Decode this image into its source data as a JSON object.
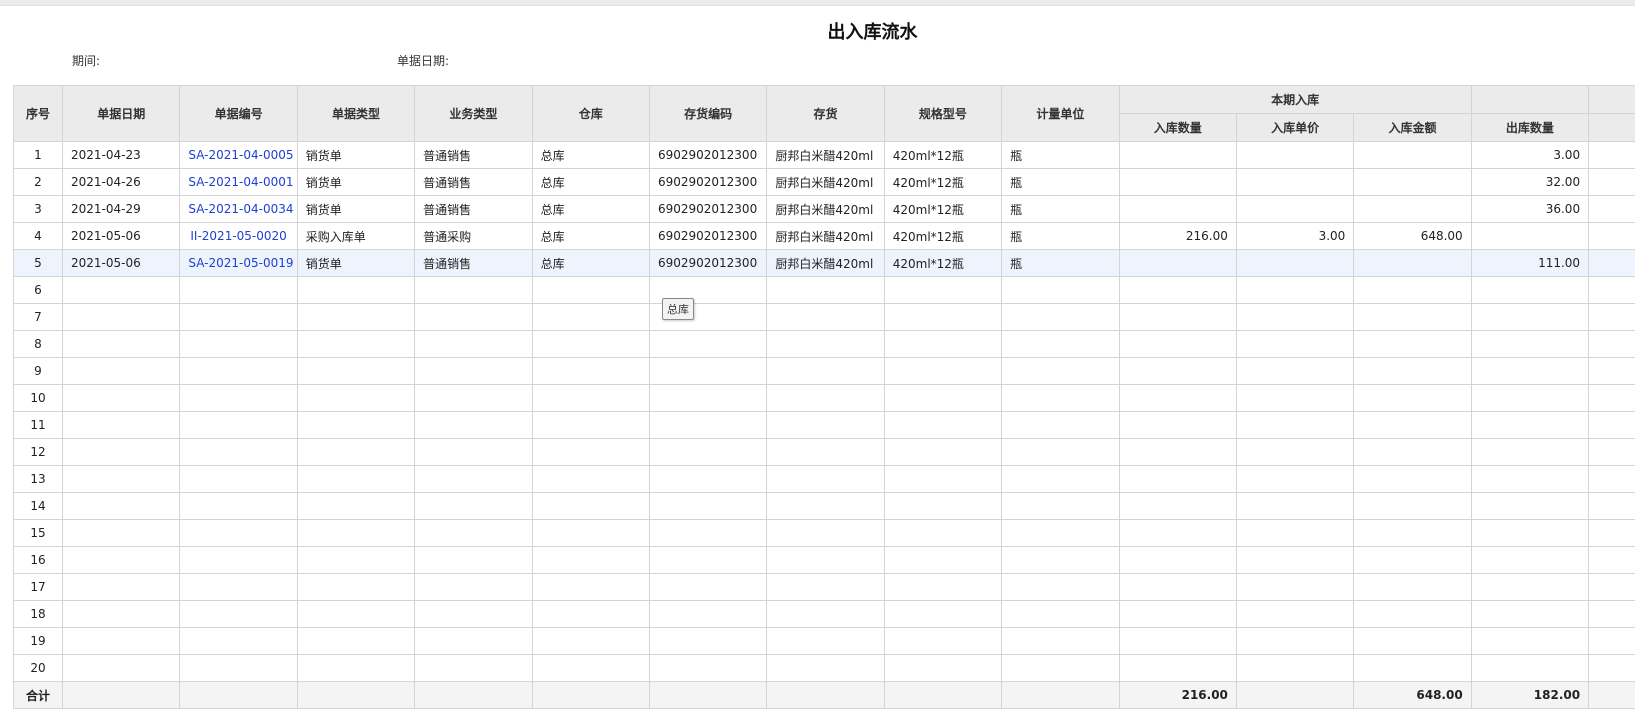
{
  "report": {
    "title": "出入库流水",
    "period_label": "期间:",
    "doc_date_label": "单据日期:"
  },
  "table": {
    "headers": {
      "seq": "序号",
      "doc_date": "单据日期",
      "doc_no": "单据编号",
      "doc_type": "单据类型",
      "biz_type": "业务类型",
      "warehouse": "仓库",
      "item_code": "存货编码",
      "item": "存货",
      "spec": "规格型号",
      "unit": "计量单位",
      "in_group": "本期入库",
      "in_qty": "入库数量",
      "in_price": "入库单价",
      "in_amount": "入库金额",
      "out_qty": "出库数量"
    },
    "rows": [
      {
        "seq": "1",
        "date": "2021-04-23",
        "doc_no": "SA-2021-04-0005",
        "doc_type": "销货单",
        "biz_type": "普通销售",
        "warehouse": "总库",
        "item_code": "6902902012300",
        "item": "厨邦白米醋420ml",
        "spec": "420ml*12瓶",
        "unit": "瓶",
        "in_qty": "",
        "in_price": "",
        "in_amount": "",
        "out_qty": "3.00"
      },
      {
        "seq": "2",
        "date": "2021-04-26",
        "doc_no": "SA-2021-04-0001",
        "doc_type": "销货单",
        "biz_type": "普通销售",
        "warehouse": "总库",
        "item_code": "6902902012300",
        "item": "厨邦白米醋420ml",
        "spec": "420ml*12瓶",
        "unit": "瓶",
        "in_qty": "",
        "in_price": "",
        "in_amount": "",
        "out_qty": "32.00"
      },
      {
        "seq": "3",
        "date": "2021-04-29",
        "doc_no": "SA-2021-04-0034",
        "doc_type": "销货单",
        "biz_type": "普通销售",
        "warehouse": "总库",
        "item_code": "6902902012300",
        "item": "厨邦白米醋420ml",
        "spec": "420ml*12瓶",
        "unit": "瓶",
        "in_qty": "",
        "in_price": "",
        "in_amount": "",
        "out_qty": "36.00"
      },
      {
        "seq": "4",
        "date": "2021-05-06",
        "doc_no": "II-2021-05-0020",
        "doc_type": "采购入库单",
        "biz_type": "普通采购",
        "warehouse": "总库",
        "item_code": "6902902012300",
        "item": "厨邦白米醋420ml",
        "spec": "420ml*12瓶",
        "unit": "瓶",
        "in_qty": "216.00",
        "in_price": "3.00",
        "in_amount": "648.00",
        "out_qty": ""
      },
      {
        "seq": "5",
        "date": "2021-05-06",
        "doc_no": "SA-2021-05-0019",
        "doc_type": "销货单",
        "biz_type": "普通销售",
        "warehouse": "总库",
        "item_code": "6902902012300",
        "item": "厨邦白米醋420ml",
        "spec": "420ml*12瓶",
        "unit": "瓶",
        "in_qty": "",
        "in_price": "",
        "in_amount": "",
        "out_qty": "111.00"
      }
    ],
    "empty_row_numbers": [
      "6",
      "7",
      "8",
      "9",
      "10",
      "11",
      "12",
      "13",
      "14",
      "15",
      "16",
      "17",
      "18",
      "19",
      "20"
    ],
    "selected_row": 5,
    "total": {
      "label": "合计",
      "in_qty": "216.00",
      "in_amount": "648.00",
      "out_qty": "182.00"
    }
  },
  "tooltip": {
    "text": "总库"
  }
}
